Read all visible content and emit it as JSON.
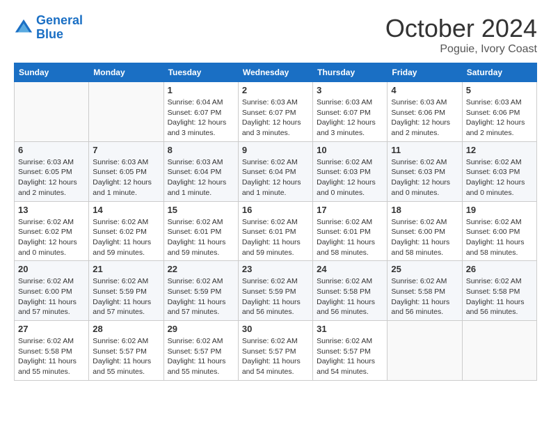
{
  "header": {
    "logo_line1": "General",
    "logo_line2": "Blue",
    "month_title": "October 2024",
    "location": "Poguie, Ivory Coast"
  },
  "weekdays": [
    "Sunday",
    "Monday",
    "Tuesday",
    "Wednesday",
    "Thursday",
    "Friday",
    "Saturday"
  ],
  "weeks": [
    [
      {
        "day": "",
        "info": ""
      },
      {
        "day": "",
        "info": ""
      },
      {
        "day": "1",
        "info": "Sunrise: 6:04 AM\nSunset: 6:07 PM\nDaylight: 12 hours and 3 minutes."
      },
      {
        "day": "2",
        "info": "Sunrise: 6:03 AM\nSunset: 6:07 PM\nDaylight: 12 hours and 3 minutes."
      },
      {
        "day": "3",
        "info": "Sunrise: 6:03 AM\nSunset: 6:07 PM\nDaylight: 12 hours and 3 minutes."
      },
      {
        "day": "4",
        "info": "Sunrise: 6:03 AM\nSunset: 6:06 PM\nDaylight: 12 hours and 2 minutes."
      },
      {
        "day": "5",
        "info": "Sunrise: 6:03 AM\nSunset: 6:06 PM\nDaylight: 12 hours and 2 minutes."
      }
    ],
    [
      {
        "day": "6",
        "info": "Sunrise: 6:03 AM\nSunset: 6:05 PM\nDaylight: 12 hours and 2 minutes."
      },
      {
        "day": "7",
        "info": "Sunrise: 6:03 AM\nSunset: 6:05 PM\nDaylight: 12 hours and 1 minute."
      },
      {
        "day": "8",
        "info": "Sunrise: 6:03 AM\nSunset: 6:04 PM\nDaylight: 12 hours and 1 minute."
      },
      {
        "day": "9",
        "info": "Sunrise: 6:02 AM\nSunset: 6:04 PM\nDaylight: 12 hours and 1 minute."
      },
      {
        "day": "10",
        "info": "Sunrise: 6:02 AM\nSunset: 6:03 PM\nDaylight: 12 hours and 0 minutes."
      },
      {
        "day": "11",
        "info": "Sunrise: 6:02 AM\nSunset: 6:03 PM\nDaylight: 12 hours and 0 minutes."
      },
      {
        "day": "12",
        "info": "Sunrise: 6:02 AM\nSunset: 6:03 PM\nDaylight: 12 hours and 0 minutes."
      }
    ],
    [
      {
        "day": "13",
        "info": "Sunrise: 6:02 AM\nSunset: 6:02 PM\nDaylight: 12 hours and 0 minutes."
      },
      {
        "day": "14",
        "info": "Sunrise: 6:02 AM\nSunset: 6:02 PM\nDaylight: 11 hours and 59 minutes."
      },
      {
        "day": "15",
        "info": "Sunrise: 6:02 AM\nSunset: 6:01 PM\nDaylight: 11 hours and 59 minutes."
      },
      {
        "day": "16",
        "info": "Sunrise: 6:02 AM\nSunset: 6:01 PM\nDaylight: 11 hours and 59 minutes."
      },
      {
        "day": "17",
        "info": "Sunrise: 6:02 AM\nSunset: 6:01 PM\nDaylight: 11 hours and 58 minutes."
      },
      {
        "day": "18",
        "info": "Sunrise: 6:02 AM\nSunset: 6:00 PM\nDaylight: 11 hours and 58 minutes."
      },
      {
        "day": "19",
        "info": "Sunrise: 6:02 AM\nSunset: 6:00 PM\nDaylight: 11 hours and 58 minutes."
      }
    ],
    [
      {
        "day": "20",
        "info": "Sunrise: 6:02 AM\nSunset: 6:00 PM\nDaylight: 11 hours and 57 minutes."
      },
      {
        "day": "21",
        "info": "Sunrise: 6:02 AM\nSunset: 5:59 PM\nDaylight: 11 hours and 57 minutes."
      },
      {
        "day": "22",
        "info": "Sunrise: 6:02 AM\nSunset: 5:59 PM\nDaylight: 11 hours and 57 minutes."
      },
      {
        "day": "23",
        "info": "Sunrise: 6:02 AM\nSunset: 5:59 PM\nDaylight: 11 hours and 56 minutes."
      },
      {
        "day": "24",
        "info": "Sunrise: 6:02 AM\nSunset: 5:58 PM\nDaylight: 11 hours and 56 minutes."
      },
      {
        "day": "25",
        "info": "Sunrise: 6:02 AM\nSunset: 5:58 PM\nDaylight: 11 hours and 56 minutes."
      },
      {
        "day": "26",
        "info": "Sunrise: 6:02 AM\nSunset: 5:58 PM\nDaylight: 11 hours and 56 minutes."
      }
    ],
    [
      {
        "day": "27",
        "info": "Sunrise: 6:02 AM\nSunset: 5:58 PM\nDaylight: 11 hours and 55 minutes."
      },
      {
        "day": "28",
        "info": "Sunrise: 6:02 AM\nSunset: 5:57 PM\nDaylight: 11 hours and 55 minutes."
      },
      {
        "day": "29",
        "info": "Sunrise: 6:02 AM\nSunset: 5:57 PM\nDaylight: 11 hours and 55 minutes."
      },
      {
        "day": "30",
        "info": "Sunrise: 6:02 AM\nSunset: 5:57 PM\nDaylight: 11 hours and 54 minutes."
      },
      {
        "day": "31",
        "info": "Sunrise: 6:02 AM\nSunset: 5:57 PM\nDaylight: 11 hours and 54 minutes."
      },
      {
        "day": "",
        "info": ""
      },
      {
        "day": "",
        "info": ""
      }
    ]
  ]
}
